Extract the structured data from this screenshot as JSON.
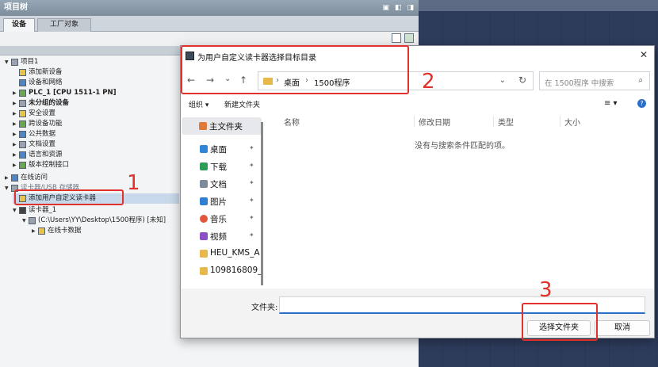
{
  "project_tree": {
    "title": "项目树",
    "window_buttons": [
      "▣",
      "◧",
      "◨"
    ],
    "tabs": [
      "设备",
      "工厂对象"
    ],
    "items": [
      {
        "label": "项目1",
        "arrow": "▼",
        "icon": "project-icon"
      },
      {
        "label": "添加新设备",
        "arrow": "",
        "icon": "add-device-icon"
      },
      {
        "label": "设备和网络",
        "arrow": "",
        "icon": "network-icon"
      },
      {
        "label": "PLC_1 [CPU 1511-1 PN]",
        "arrow": "▶",
        "icon": "plc-icon"
      },
      {
        "label": "未分组的设备",
        "arrow": "▶",
        "icon": "ungrouped-devices-icon"
      },
      {
        "label": "安全设置",
        "arrow": "▶",
        "icon": "security-icon"
      },
      {
        "label": "跨设备功能",
        "arrow": "▶",
        "icon": "cross-device-icon"
      },
      {
        "label": "公共数据",
        "arrow": "▶",
        "icon": "common-data-icon"
      },
      {
        "label": "文档设置",
        "arrow": "▶",
        "icon": "document-settings-icon"
      },
      {
        "label": "语言和资源",
        "arrow": "▶",
        "icon": "language-icon"
      },
      {
        "label": "版本控制接口",
        "arrow": "▶",
        "icon": "version-control-icon"
      },
      {
        "label": "在线访问",
        "arrow": "▶",
        "icon": "online-access-icon"
      },
      {
        "label": "读卡器/USB 存储器",
        "arrow": "▼",
        "icon": "card-reader-icon"
      },
      {
        "label": "添加用户自定义读卡器",
        "arrow": "",
        "icon": "add-reader-icon"
      },
      {
        "label": "读卡器_1",
        "arrow": "▼",
        "icon": "reader-icon"
      },
      {
        "label": "(C:\\Users\\YY\\Desktop\\1500程序) [未知]",
        "arrow": "▼",
        "icon": "drive-icon"
      },
      {
        "label": "在线卡数据",
        "arrow": "▶",
        "icon": "online-card-data-icon"
      }
    ]
  },
  "dialog": {
    "title": "为用户自定义读卡器选择目标目录",
    "close": "✕",
    "nav": {
      "back": "←",
      "forward": "→",
      "dropdown": "⌄",
      "up": "↑"
    },
    "breadcrumb": [
      "桌面",
      "1500程序"
    ],
    "breadcrumb_sep": "›",
    "address_dropdown": "⌄",
    "refresh": "↻",
    "search_placeholder": "在 1500程序 中搜索",
    "search_icon": "⌕",
    "organize": "组织 ▾",
    "new_folder": "新建文件夹",
    "view_icon": "≡ ▾",
    "help_icon": "?",
    "sidebar": {
      "home": "主文件夹",
      "items": [
        {
          "label": "桌面",
          "icon": "desktop-icon",
          "color": "#2f86d6",
          "pinned": true
        },
        {
          "label": "下载",
          "icon": "download-icon",
          "color": "#2e9d57",
          "pinned": true
        },
        {
          "label": "文档",
          "icon": "documents-icon",
          "color": "#7d8a99",
          "pinned": true
        },
        {
          "label": "图片",
          "icon": "pictures-icon",
          "color": "#2f7fd1",
          "pinned": true
        },
        {
          "label": "音乐",
          "icon": "music-icon",
          "color": "#e2573b",
          "pinned": true
        },
        {
          "label": "视频",
          "icon": "videos-icon",
          "color": "#8b4fc6",
          "pinned": true
        },
        {
          "label": "HEU_KMS_A",
          "icon": "folder-icon",
          "color": "#e7b84a",
          "pinned": false
        },
        {
          "label": "109816809_",
          "icon": "folder-icon",
          "color": "#e7b84a",
          "pinned": false
        }
      ],
      "pin_glyph": "📌"
    },
    "columns": [
      "名称",
      "修改日期",
      "类型",
      "大小"
    ],
    "empty_message": "没有与搜索条件匹配的项。",
    "folder_label": "文件夹:",
    "folder_value": "",
    "select_button": "选择文件夹",
    "cancel_button": "取消"
  },
  "annotations": [
    "1",
    "2",
    "3"
  ],
  "colors": {
    "annotation": "#e0312c",
    "accent": "#2a6fc9"
  }
}
